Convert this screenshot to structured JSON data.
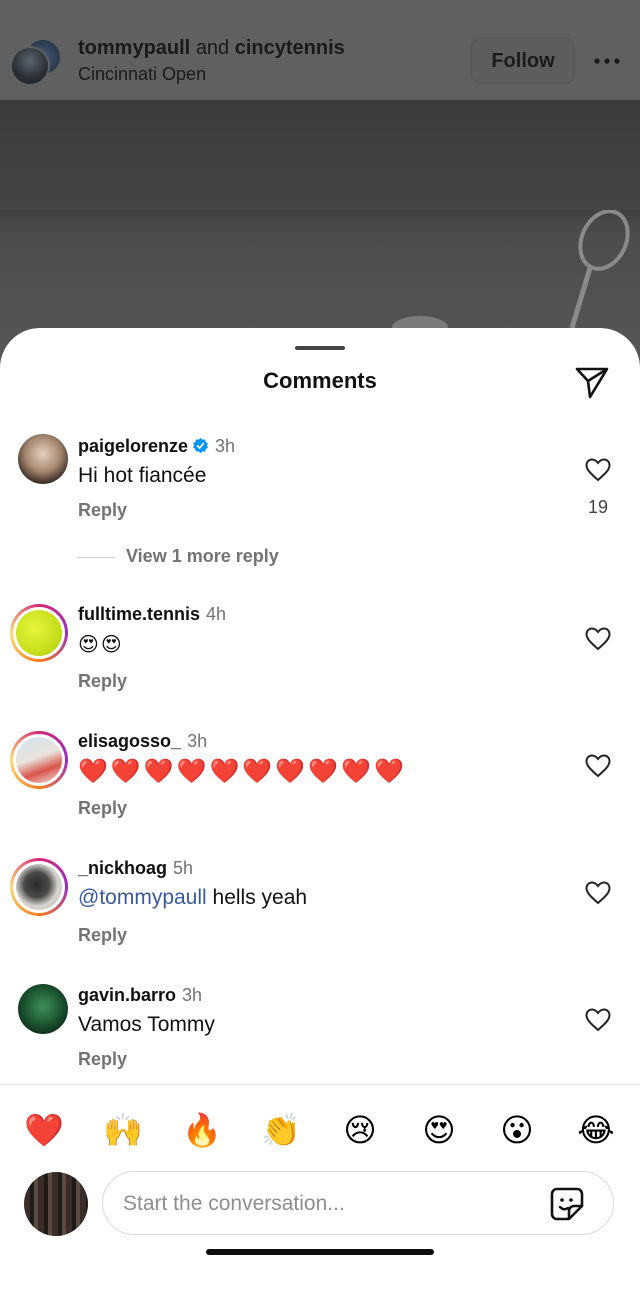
{
  "post": {
    "user1": "tommypaull",
    "joiner": "and",
    "user2": "cincytennis",
    "location": "Cincinnati Open",
    "follow_label": "Follow"
  },
  "sheet": {
    "title": "Comments"
  },
  "comments": [
    {
      "username": "paigelorenze",
      "verified": true,
      "time": "3h",
      "text": "Hi hot fiancée",
      "reply_label": "Reply",
      "likes": "19",
      "view_more": "View 1 more reply"
    },
    {
      "username": "fulltime.tennis",
      "time": "4h",
      "text": "😍😍",
      "reply_label": "Reply"
    },
    {
      "username": "elisagosso_",
      "time": "3h",
      "text": "❤️❤️❤️❤️❤️❤️❤️❤️❤️❤️",
      "reply_label": "Reply"
    },
    {
      "username": "_nickhoag",
      "time": "5h",
      "mention": "@tommypaull",
      "text": "hells yeah",
      "reply_label": "Reply"
    },
    {
      "username": "gavin.barro",
      "time": "3h",
      "text": "Vamos Tommy",
      "reply_label": "Reply"
    }
  ],
  "reactions": [
    "❤️",
    "🙌",
    "🔥",
    "👏",
    "😢",
    "😍",
    "😮",
    "😂"
  ],
  "composer": {
    "placeholder": "Start the conversation..."
  },
  "colors": {
    "accent_mention": "#3a5a9b",
    "verified_blue": "#0095f6",
    "heart_red": "#e0143c"
  }
}
